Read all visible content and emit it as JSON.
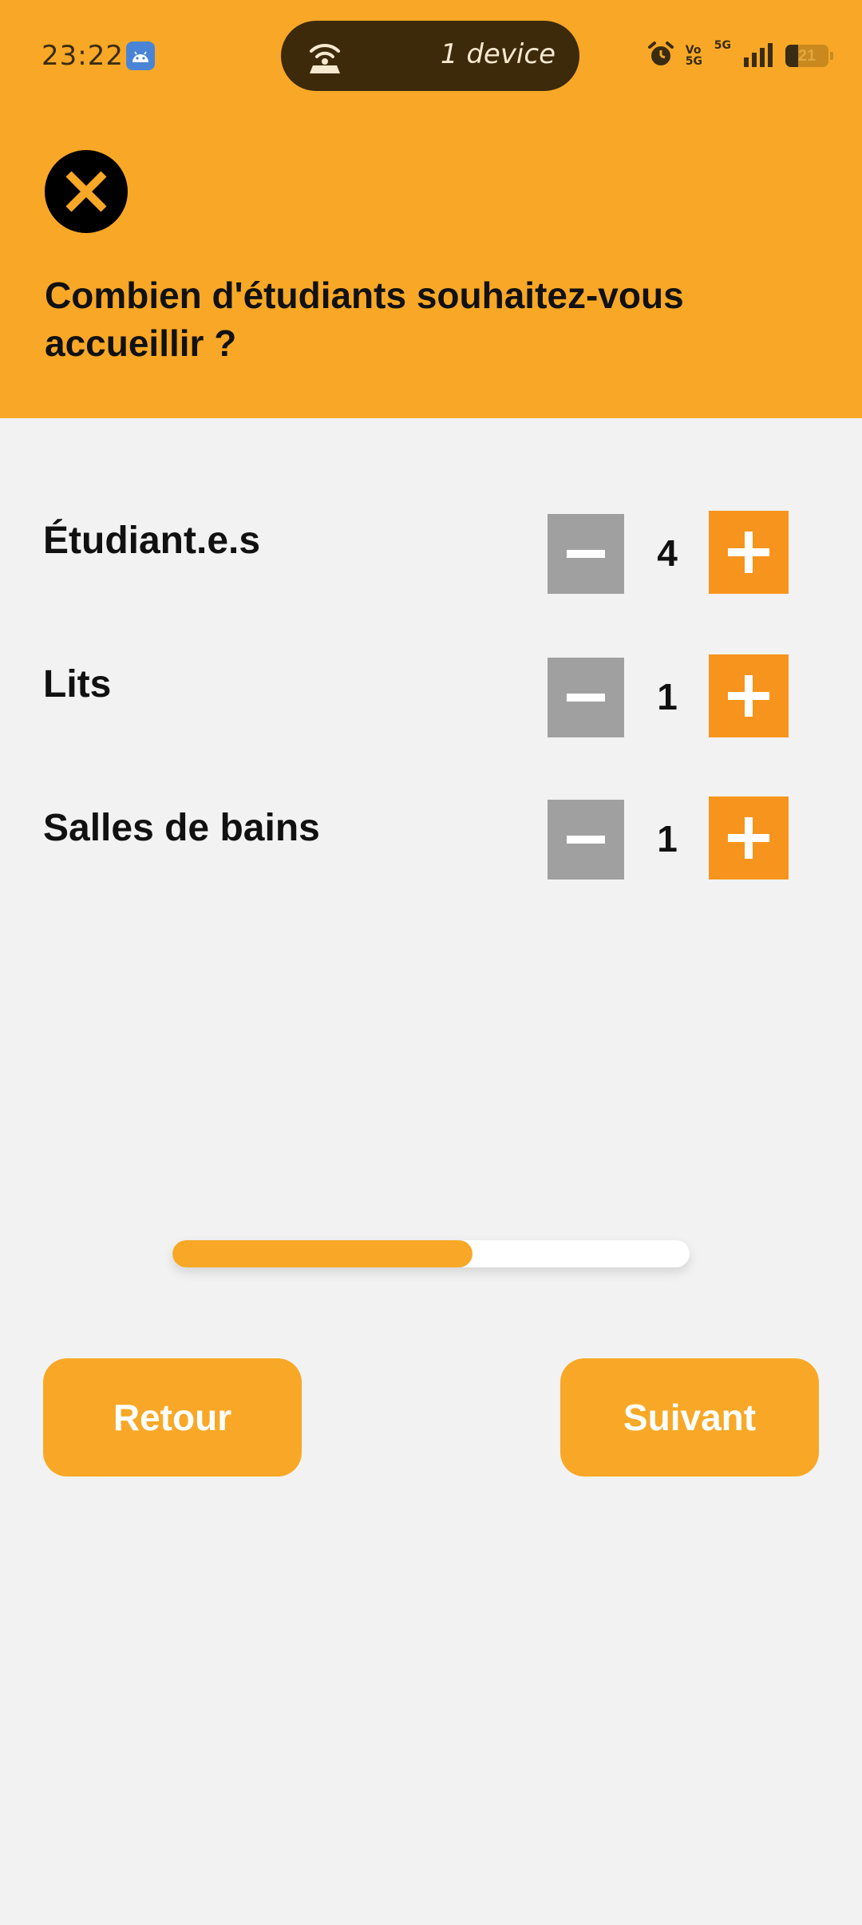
{
  "status_bar": {
    "time": "23:22",
    "app_icon": "android-icon",
    "pill_icon": "hotspot-icon",
    "pill_text": "1 device",
    "volte_label": "Vo 5G",
    "network_label": "5G",
    "battery_level": "21",
    "alarm_icon": "alarm-icon",
    "signal_icon": "signal-icon"
  },
  "header": {
    "close_icon": "close-icon",
    "title": "Combien d'étudiants souhaitez-vous accueillir ?"
  },
  "counters": [
    {
      "label": "Étudiant.e.s",
      "value": "4"
    },
    {
      "label": "Lits",
      "value": "1"
    },
    {
      "label": "Salles de bains",
      "value": "1"
    }
  ],
  "progress": {
    "fraction": 0.58
  },
  "actions": {
    "back_label": "Retour",
    "next_label": "Suivant"
  },
  "colors": {
    "accent": "#f8a826",
    "plus_button": "#f7941d",
    "minus_button": "#a0a0a0",
    "background": "#f2f2f2"
  }
}
